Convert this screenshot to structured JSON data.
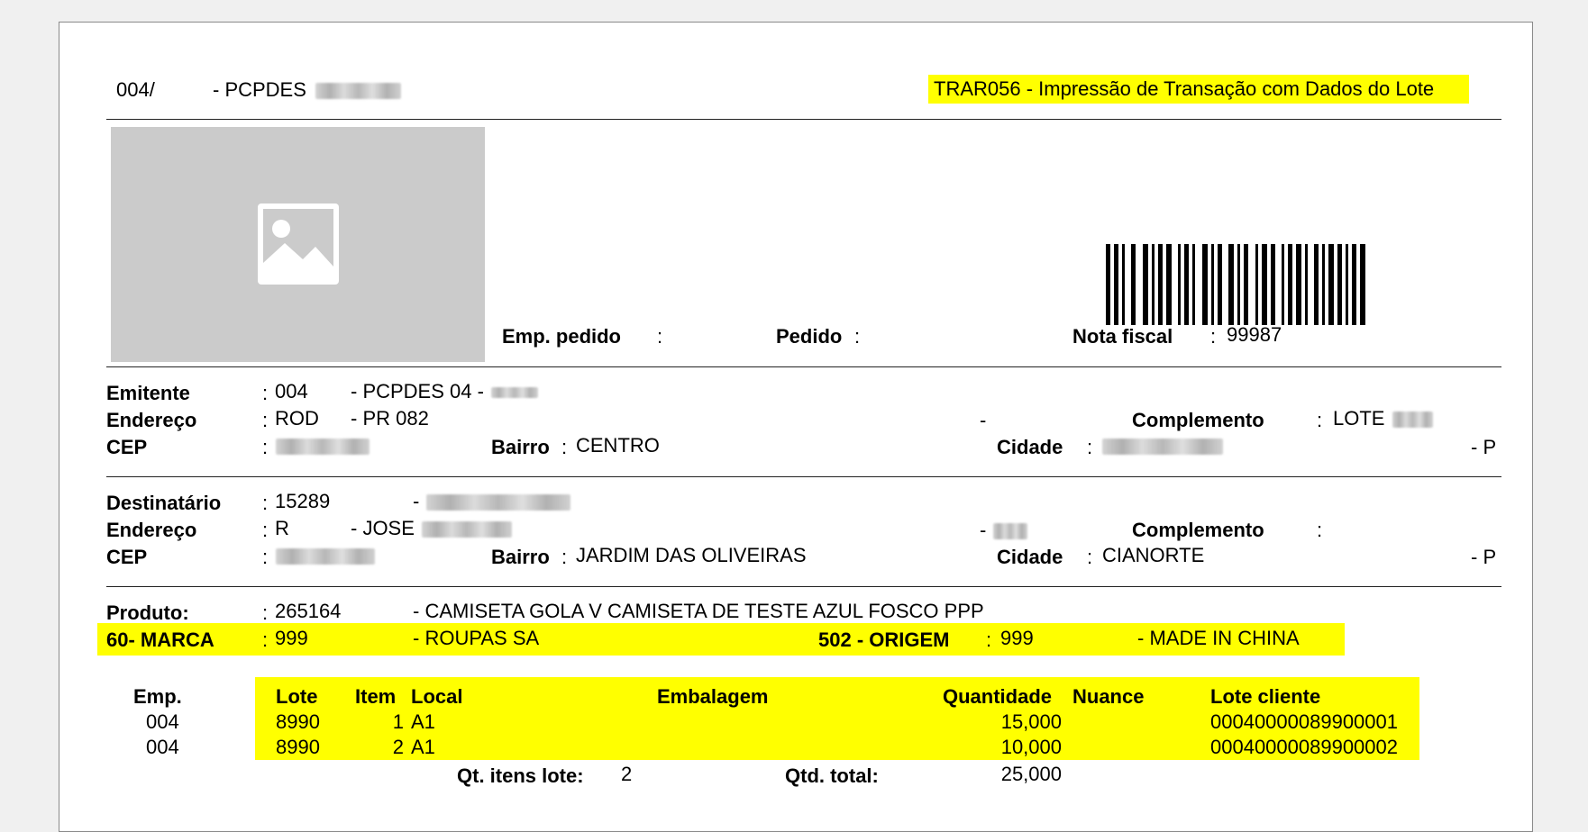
{
  "header": {
    "code": "004/",
    "company": "- PCPDES",
    "report_title": "TRAR056 - Impressão de Transação com Dados do Lote"
  },
  "order": {
    "emp_pedido_label": "Emp. pedido",
    "pedido_label": "Pedido",
    "nota_fiscal_label": "Nota fiscal",
    "nota_fiscal_value": "99987",
    "colon": ":"
  },
  "issuer": {
    "emitente_label": "Emitente",
    "emitente_code": "004",
    "emitente_name": "- PCPDES 04 -",
    "endereco_label": "Endereço",
    "endereco_type": "ROD",
    "endereco_street": "- PR 082",
    "endereco_sep": "-",
    "complemento_label": "Complemento",
    "complemento_value": "LOTE",
    "cep_label": "CEP",
    "bairro_label": "Bairro",
    "bairro_value": "CENTRO",
    "cidade_label": "Cidade",
    "uf": "- P"
  },
  "recipient": {
    "destinatario_label": "Destinatário",
    "destinatario_code": "15289",
    "destinatario_sep": "-",
    "endereco_label": "Endereço",
    "endereco_type": "R",
    "endereco_street": "- JOSE",
    "endereco_sep": "-",
    "complemento_label": "Complemento",
    "cep_label": "CEP",
    "bairro_label": "Bairro",
    "bairro_value": "JARDIM DAS OLIVEIRAS",
    "cidade_label": "Cidade",
    "cidade_value": "CIANORTE",
    "uf": "- P"
  },
  "product": {
    "produto_label": "Produto:",
    "produto_code": "265164",
    "produto_desc": "- CAMISETA GOLA V CAMISETA DE TESTE AZUL FOSCO PPP",
    "marca_label": "60- MARCA",
    "marca_code": "999",
    "marca_desc": "- ROUPAS SA",
    "origem_label": "502 - ORIGEM",
    "origem_code": "999",
    "origem_desc": "- MADE IN CHINA"
  },
  "lots": {
    "headers": {
      "emp": "Emp.",
      "lote": "Lote",
      "item": "Item",
      "local": "Local",
      "embalagem": "Embalagem",
      "quantidade": "Quantidade",
      "nuance": "Nuance",
      "lote_cliente": "Lote cliente"
    },
    "rows": [
      {
        "emp": "004",
        "lote": "8990",
        "item": "1",
        "local": "A1",
        "embalagem": "",
        "quantidade": "15,000",
        "nuance": "",
        "lote_cliente": "00040000089900001"
      },
      {
        "emp": "004",
        "lote": "8990",
        "item": "2",
        "local": "A1",
        "embalagem": "",
        "quantidade": "10,000",
        "nuance": "",
        "lote_cliente": "00040000089900002"
      }
    ],
    "qt_itens_label": "Qt. itens lote:",
    "qt_itens_value": "2",
    "qtd_total_label": "Qtd. total:",
    "qtd_total_value": "25,000"
  },
  "icons": {
    "photo": "image-placeholder-icon",
    "barcode": "barcode"
  },
  "colors": {
    "highlight": "#ffff00",
    "photo_bg": "#cbcbcb"
  }
}
